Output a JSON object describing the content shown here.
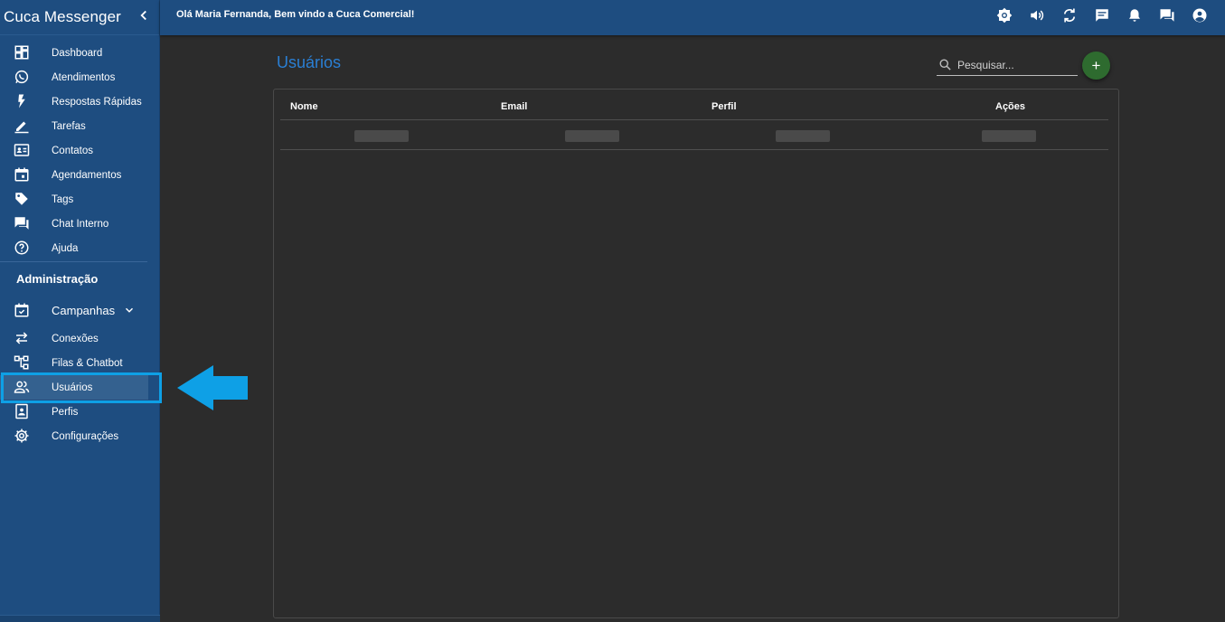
{
  "app": {
    "title": "Cuca Messenger"
  },
  "topbar": {
    "welcome": "Olá Maria Fernanda, Bem vindo a Cuca Comercial!"
  },
  "sidebar": {
    "items": [
      {
        "label": "Dashboard"
      },
      {
        "label": "Atendimentos"
      },
      {
        "label": "Respostas Rápidas"
      },
      {
        "label": "Tarefas"
      },
      {
        "label": "Contatos"
      },
      {
        "label": "Agendamentos"
      },
      {
        "label": "Tags"
      },
      {
        "label": "Chat Interno"
      },
      {
        "label": "Ajuda"
      }
    ],
    "admin_title": "Administração",
    "admin_items": [
      {
        "label": "Campanhas"
      },
      {
        "label": "Conexões"
      },
      {
        "label": "Filas & Chatbot"
      },
      {
        "label": "Usuários"
      },
      {
        "label": "Perfis"
      },
      {
        "label": "Configurações"
      }
    ],
    "active_item": "Usuários"
  },
  "main": {
    "title": "Usuários",
    "search_placeholder": "Pesquisar...",
    "add_label": "+",
    "columns": [
      "Nome",
      "Email",
      "Perfil",
      "Ações"
    ]
  },
  "colors": {
    "sidebar_bg": "#1e4d80",
    "accent": "#2a7fd4",
    "highlight": "#0ea0e6",
    "add_button": "#2e6b2f"
  }
}
